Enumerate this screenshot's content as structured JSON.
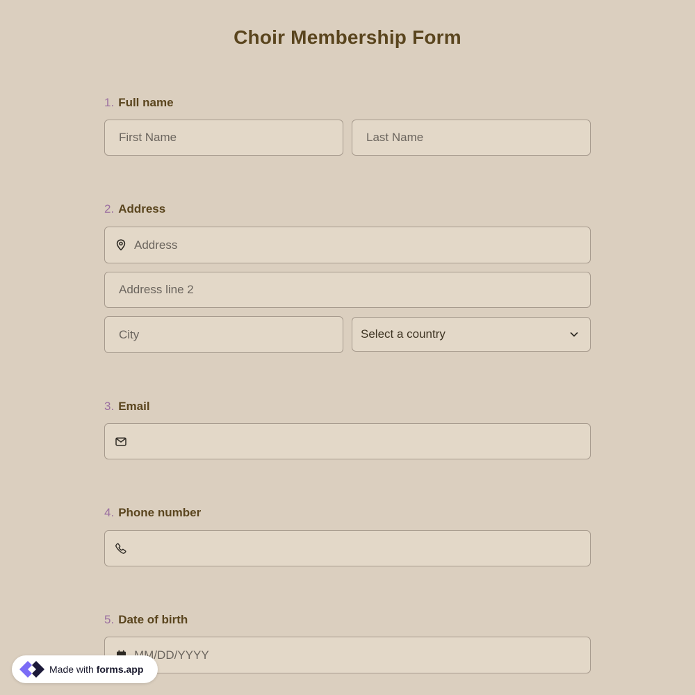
{
  "form": {
    "title": "Choir Membership Form"
  },
  "questions": [
    {
      "number": "1.",
      "label": "Full name",
      "fields": [
        {
          "placeholder": "First Name"
        },
        {
          "placeholder": "Last Name"
        }
      ]
    },
    {
      "number": "2.",
      "label": "Address",
      "fields": [
        {
          "placeholder": "Address",
          "icon": "location-pin-icon"
        },
        {
          "placeholder": "Address line 2"
        },
        {
          "placeholder": "City"
        },
        {
          "selected": "Select a country",
          "icon": "chevron-down-icon"
        }
      ]
    },
    {
      "number": "3.",
      "label": "Email",
      "fields": [
        {
          "placeholder": "",
          "icon": "envelope-icon"
        }
      ]
    },
    {
      "number": "4.",
      "label": "Phone number",
      "fields": [
        {
          "placeholder": "",
          "icon": "phone-icon"
        }
      ]
    },
    {
      "number": "5.",
      "label": "Date of birth",
      "fields": [
        {
          "placeholder": "MM/DD/YYYY",
          "icon": "calendar-icon"
        }
      ]
    }
  ],
  "badge": {
    "prefix": "Made with",
    "brand": "forms.app",
    "icon": "forms-app-logo-icon"
  },
  "colors": {
    "background": "#dbcfbf",
    "title": "#5a451e",
    "question_number": "#9b6fa0",
    "field_background": "#e3d8c8",
    "field_border": "#a69a8d"
  }
}
